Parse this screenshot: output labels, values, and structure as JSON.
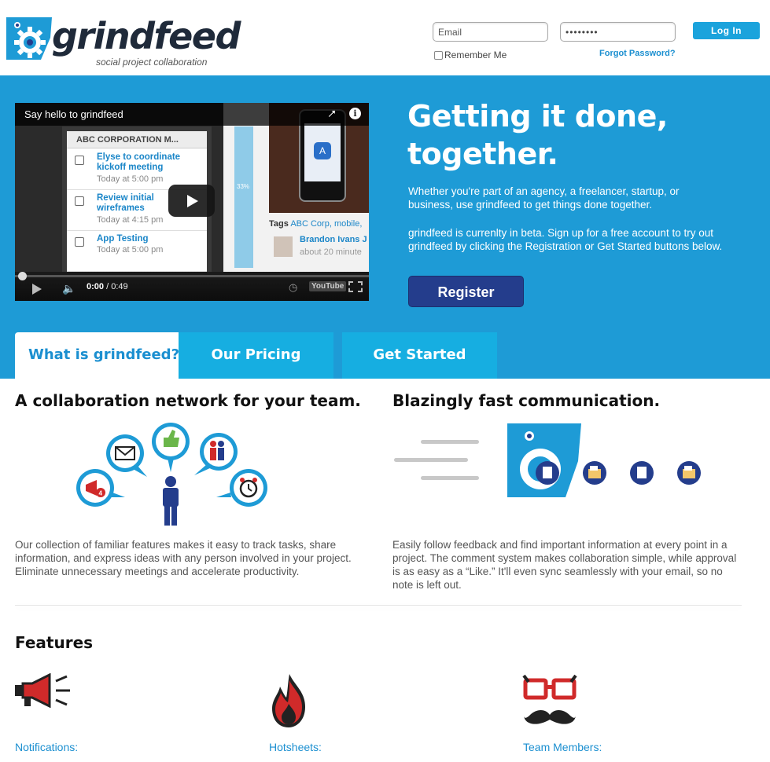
{
  "brand": {
    "name": "grindfeed",
    "tagline": "social project collaboration",
    "accent": "#1e9bd6",
    "dark": "#243d8c"
  },
  "login": {
    "email_placeholder": "Email",
    "password_value": "••••••••",
    "login_label": "Log In",
    "remember_label": "Remember Me",
    "forgot_label": "Forgot Password?"
  },
  "video": {
    "title": "Say hello to grindfeed",
    "time_current": "0:00",
    "time_total": " / 0:49",
    "progress": 0,
    "screen_header": "ABC CORPORATION M...",
    "tasks": [
      {
        "title": "Elyse to coordinate kickoff meeting",
        "when": "Today at 5:00 pm"
      },
      {
        "title": "Review initial wireframes",
        "when": "Today at 4:15 pm"
      },
      {
        "title": "App Testing",
        "when": "Today at 5:00 pm"
      }
    ],
    "bar_value": "33%",
    "tags_label": "Tags",
    "tags_value": "ABC Corp, mobile,",
    "user_name": "Brandon Ivans J",
    "user_time": "about 20 minute",
    "yt_label": "YouTube"
  },
  "hero": {
    "headline": "Getting it done, together.",
    "p1": "Whether you're part of an agency, a freelancer, startup, or business, use grindfeed to get things done together.",
    "p2": "grindfeed is currenlty in beta. Sign up for a free account to try out grindfeed by clicking the Registration or Get Started buttons below.",
    "register_label": "Register"
  },
  "tabs": [
    {
      "label": "What is grindfeed?",
      "active": true
    },
    {
      "label": "Our Pricing",
      "active": false
    },
    {
      "label": "Get Started",
      "active": false
    }
  ],
  "sections": {
    "left": {
      "title": "A collaboration network for your team.",
      "text": "Our collection of familiar features makes it easy to track tasks, share information, and express ideas with any person involved in your project. Eliminate unnecessary meetings and accelerate productivity.",
      "badge": "4"
    },
    "right": {
      "title": "Blazingly fast communication.",
      "text": "Easily follow feedback and find important information at every point in a project. The comment system makes collaboration simple, while approval is as easy as a “Like.” It'll even sync seamlessly with your email, so no note is left out."
    }
  },
  "features": {
    "title": "Features",
    "items": [
      {
        "label": "Notifications:",
        "icon": "megaphone-icon"
      },
      {
        "label": "Hotsheets:",
        "icon": "flame-icon"
      },
      {
        "label": "Team Members:",
        "icon": "glasses-mustache-icon"
      }
    ]
  }
}
